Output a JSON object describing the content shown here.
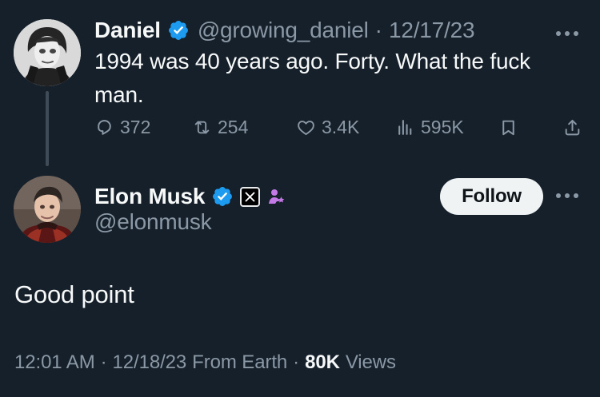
{
  "parent_tweet": {
    "display_name": "Daniel",
    "handle": "@growing_daniel",
    "separator": "·",
    "date": "12/17/23",
    "text": "1994 was 40 years ago. Forty. What the fuck man.",
    "actions": {
      "replies": "372",
      "reposts": "254",
      "likes": "3.4K",
      "views": "595K"
    }
  },
  "main_tweet": {
    "display_name": "Elon Musk",
    "handle": "@elonmusk",
    "follow_label": "Follow",
    "text": "Good point",
    "meta": {
      "time": "12:01 AM",
      "separator_1": "·",
      "date": "12/18/23",
      "location": "From Earth",
      "separator_2": "·",
      "views_count": "80K",
      "views_label": "Views"
    }
  },
  "icons": {
    "verified": "verified-badge-icon",
    "affiliate": "x-affiliate-icon",
    "government_or_member": "purple-user-icon",
    "more": "more-horizontal-icon",
    "reply": "reply-icon",
    "repost": "repost-icon",
    "like": "heart-icon",
    "views": "analytics-icon",
    "bookmark": "bookmark-icon",
    "share": "share-icon"
  },
  "colors": {
    "background": "#15202b",
    "primary_text": "#f7f9f9",
    "secondary_text": "#8b98a5",
    "verified_blue": "#1d9bf0",
    "purple_badge": "#c47ae6",
    "follow_button_bg": "#eff3f4",
    "follow_button_text": "#0f1419"
  }
}
